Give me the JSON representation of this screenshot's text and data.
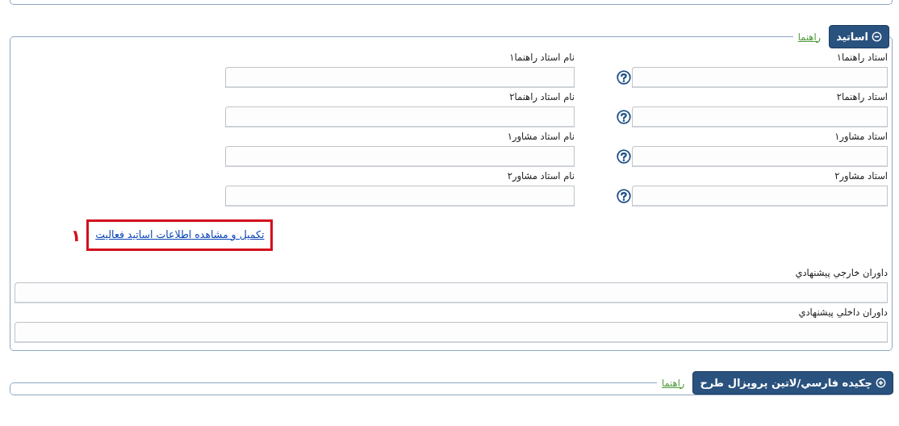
{
  "sections": [
    {
      "title": "اساتيد",
      "expanded": true,
      "help_link": "راهنما",
      "advisors": [
        {
          "label": "استاد راهنما۱",
          "name_label": "نام استاد راهنما۱"
        },
        {
          "label": "استاد راهنما۲",
          "name_label": "نام استاد راهنما۲"
        },
        {
          "label": "استاد مشاور۱",
          "name_label": "نام استاد مشاور۱"
        },
        {
          "label": "استاد مشاور۲",
          "name_label": "نام استاد مشاور۲"
        }
      ],
      "activity_link": {
        "text": "تکميل و مشاهده اطلاعات اساتيد فعاليت",
        "annotation": "۱"
      },
      "referees": [
        {
          "label": "داوران خارجي پيشنهادي"
        },
        {
          "label": "داوران داخلي پيشنهادي"
        }
      ]
    },
    {
      "title": "چکيده فارسي/لاتين پروپزال طرح",
      "expanded": false,
      "help_link": "راهنما"
    }
  ]
}
